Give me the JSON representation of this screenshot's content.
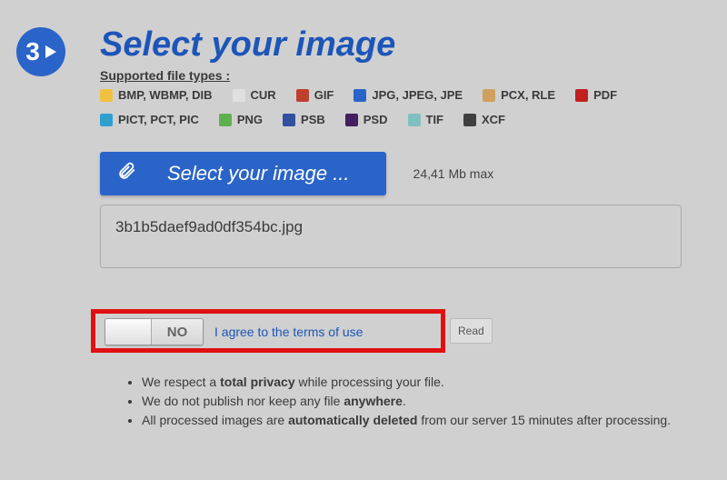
{
  "step": {
    "number": "3"
  },
  "heading": "Select your image",
  "supported": {
    "label": "Supported file types :",
    "types": [
      "BMP, WBMP, DIB",
      "CUR",
      "GIF",
      "JPG, JPEG, JPE",
      "PCX, RLE",
      "PDF",
      "PICT, PCT, PIC",
      "PNG",
      "PSB",
      "PSD",
      "TIF",
      "XCF"
    ]
  },
  "upload": {
    "button_label": "Select your image ...",
    "max_size_label": "24,41 Mb max",
    "selected_file": "3b1b5daef9ad0df354bc.jpg"
  },
  "terms": {
    "toggle_state": "NO",
    "agree_text": "I agree to the terms of use",
    "read_label": "Read"
  },
  "privacy": {
    "line1_pre": "We respect a ",
    "line1_bold": "total privacy",
    "line1_post": " while processing your file.",
    "line2_pre": "We do not publish nor keep any file ",
    "line2_bold": "anywhere",
    "line2_post": ".",
    "line3_pre": "All processed images are ",
    "line3_bold": "automatically deleted",
    "line3_post": " from our server 15 minutes after processing."
  },
  "icons": {
    "ft_colors": [
      "#f0c040",
      "#e0e0e0",
      "#c04030",
      "#2a64c8",
      "#d0a060",
      "#c02020",
      "#30a0d0",
      "#60b050",
      "#3050a0",
      "#402060",
      "#80c0c0",
      "#404040"
    ]
  }
}
